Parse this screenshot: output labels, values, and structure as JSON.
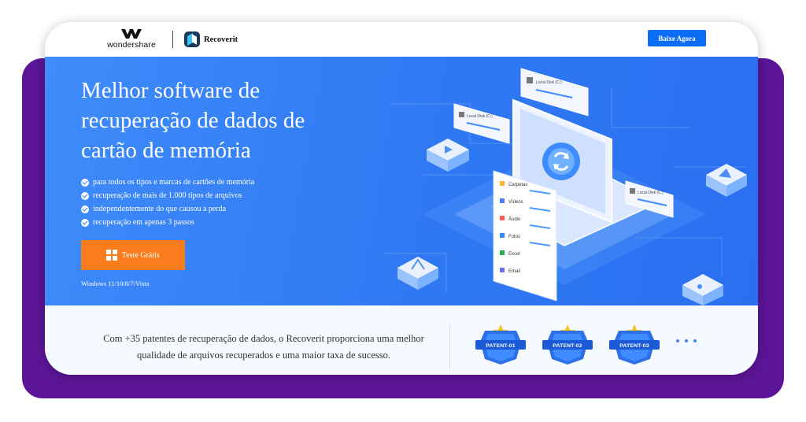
{
  "header": {
    "brand_name": "wondershare",
    "product_name": "Recoverit",
    "cta_label": "Baixe Agora"
  },
  "hero": {
    "title": "Melhor software de recuperação de dados de cartão de memória",
    "features": [
      "para todos os tipos e marcas de cartões de memória",
      "recuperação de mais de 1.000 tipos de arquivos",
      "independentemente do que causou a perda",
      "recuperação em apenas 3 passos"
    ],
    "button_label": "Teste Grátis",
    "os_note": "Windows 11/10/8/7/Vista"
  },
  "illustration": {
    "file_types": [
      "Carpetas",
      "Vídeos",
      "Áudio",
      "Fotos",
      "Excel",
      "Email"
    ],
    "drive_label": "Local Disk (C:)"
  },
  "footer": {
    "patent_text": "Com +35 patentes de recuperação de dados, o Recoverit proporciona uma melhor qualidade de arquivos recuperados e uma maior taxa de sucesso.",
    "badges": [
      "PATENT-01",
      "PATENT-02",
      "PATENT-03"
    ]
  },
  "colors": {
    "accent": "#0b6cf5",
    "hero_blue": "#2f78f2",
    "cta_orange": "#fb7c1c",
    "frame_purple": "#5c1597"
  }
}
